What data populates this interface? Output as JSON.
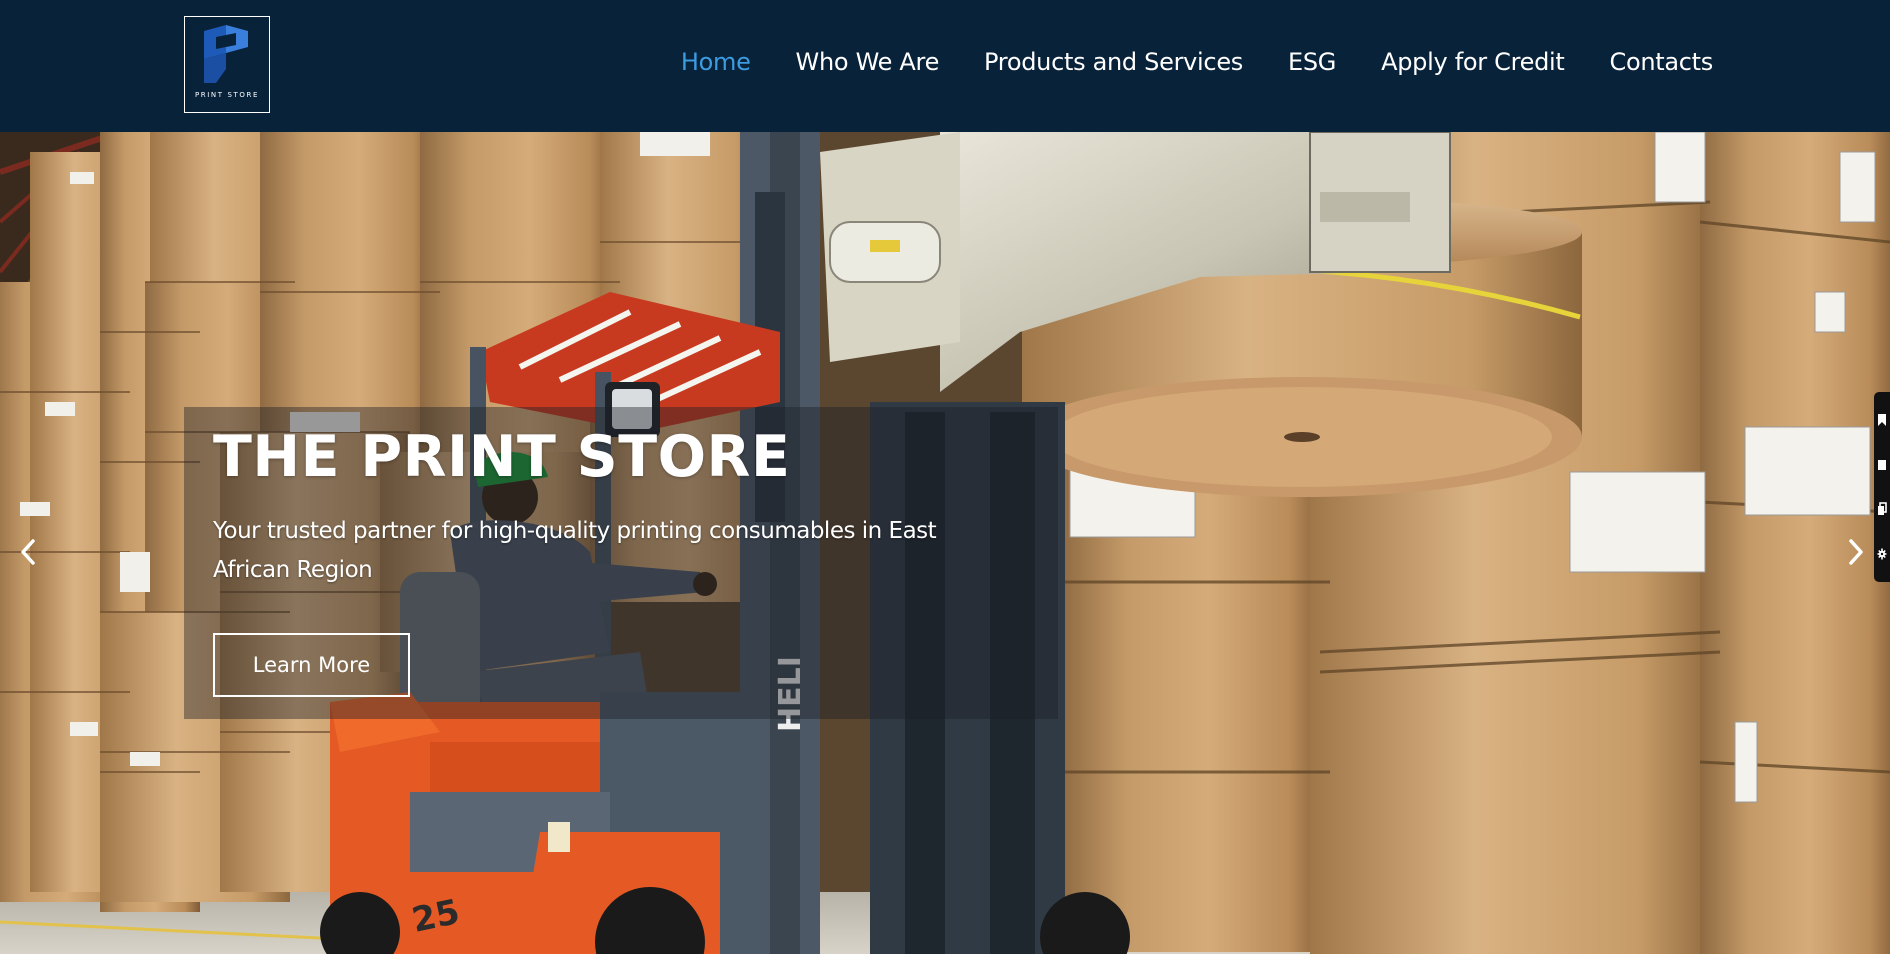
{
  "brand": {
    "logo_text": "PRINT STORE",
    "colors": {
      "header_bg": "#08223a",
      "nav_text": "#ffffff",
      "nav_active": "#3d9be0",
      "logo_blue": "#1f5fbf"
    }
  },
  "nav": {
    "items": [
      {
        "label": "Home",
        "active": true
      },
      {
        "label": "Who We Are",
        "active": false
      },
      {
        "label": "Products and Services",
        "active": false
      },
      {
        "label": "ESG",
        "active": false
      },
      {
        "label": "Apply for Credit",
        "active": false
      },
      {
        "label": "Contacts",
        "active": false
      }
    ]
  },
  "hero": {
    "title": "THE PRINT STORE",
    "subtitle": "Your trusted partner for high-quality printing consumables in East African Region",
    "cta_label": "Learn More",
    "prev_icon": "chevron-left-icon",
    "next_icon": "chevron-right-icon"
  },
  "side_toolbar": {
    "icons": [
      "bookmark-icon",
      "square-icon",
      "copy-icon",
      "gear-icon"
    ]
  }
}
